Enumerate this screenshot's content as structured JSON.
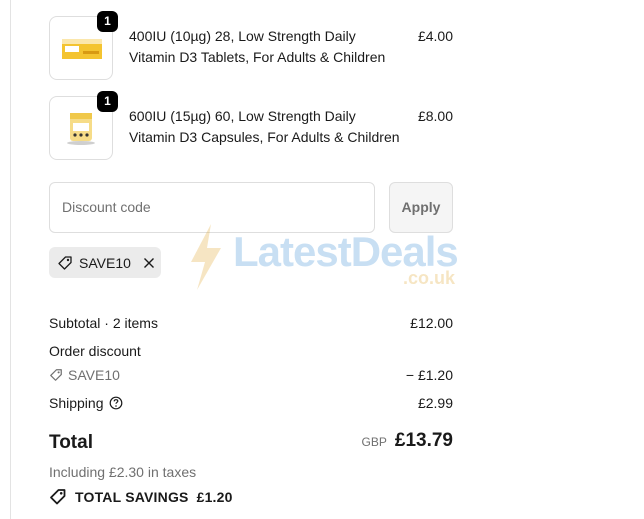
{
  "items": [
    {
      "quantity": "1",
      "name": "400IU (10µg) 28, Low Strength Daily Vitamin D3 Tablets, For Adults & Children",
      "price": "£4.00",
      "image_icon": "vitamin-box-icon"
    },
    {
      "quantity": "1",
      "name": "600IU (15µg) 60, Low Strength Daily Vitamin D3 Capsules, For Adults & Children",
      "price": "£8.00",
      "image_icon": "vitamin-tub-icon"
    }
  ],
  "discount": {
    "placeholder": "Discount code",
    "apply_label": "Apply",
    "applied_code": "SAVE10"
  },
  "summary": {
    "subtotal_label": "Subtotal · 2 items",
    "subtotal_value": "£12.00",
    "order_discount_label": "Order discount",
    "discount_code": "SAVE10",
    "discount_value": "− £1.20",
    "shipping_label": "Shipping",
    "shipping_value": "£2.99",
    "total_label": "Total",
    "currency": "GBP",
    "total_value": "£13.79",
    "taxes_note": "Including £2.30 in taxes",
    "savings_label": "TOTAL SAVINGS",
    "savings_value": "£1.20"
  },
  "watermark": {
    "text": "LatestDeals",
    "sub": ".co.uk"
  },
  "colors": {
    "badge": "#000000",
    "chip": "#ebebeb",
    "muted": "#707070",
    "watermark_blue": "#3d8fd6",
    "watermark_yellow": "#e0a62a"
  }
}
